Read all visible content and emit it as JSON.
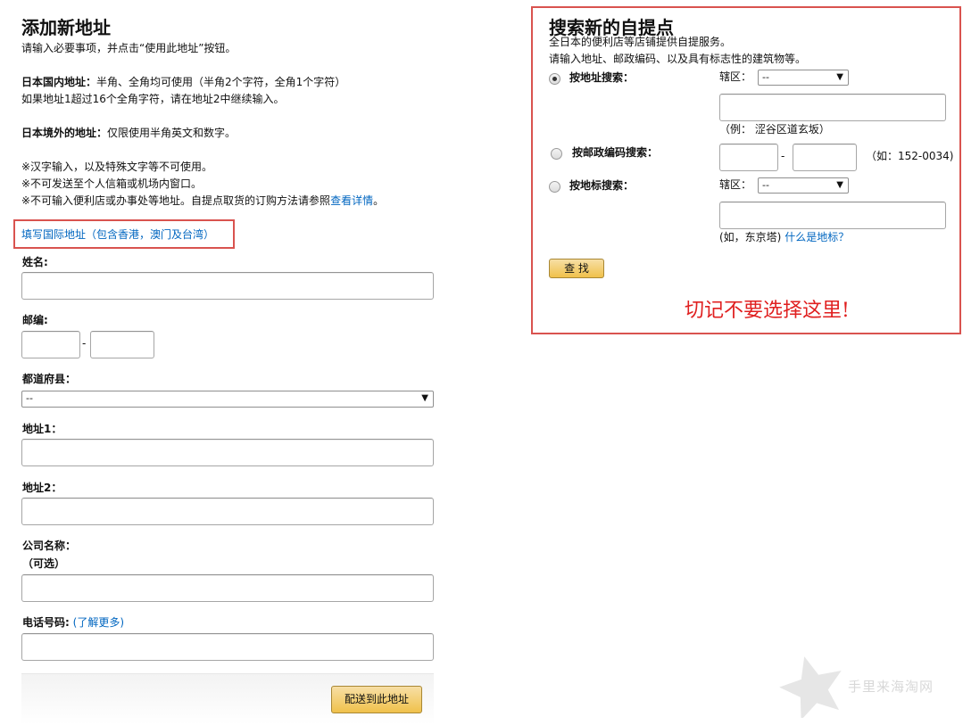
{
  "left": {
    "title": "添加新地址",
    "subtitle": "请输入必要事项，并点击“使用此地址”按钮。",
    "domestic_label": "日本国内地址：",
    "domestic_text": "半角、全角均可使用（半角2个字符，全角1个字符）",
    "domestic_note": "如果地址1超过16个全角字符，请在地址2中继续输入。",
    "overseas_label": "日本境外的地址：",
    "overseas_text": "仅限使用半角英文和数字。",
    "note1": "※汉字输入，以及特殊文字等不可使用。",
    "note2": "※不可发送至个人信箱或机场内窗口。",
    "note3": "※不可输入便利店或办事处等地址。自提点取货的订购方法请参照",
    "note3_link": "查看详情",
    "note3_end": "。",
    "intl_link": "填写国际地址（包含香港，澳门及台湾）",
    "name_label": "姓名:",
    "zip_label": "邮编:",
    "zip_dash": "-",
    "pref_label": "都道府县：",
    "pref_value": "--",
    "addr1_label": "地址1：",
    "addr2_label": "地址2：",
    "company_label": "公司名称：",
    "company_optional": "（可选）",
    "phone_label": "电话号码:",
    "phone_link_open": "(",
    "phone_link": "了解更多",
    "phone_link_close": ")",
    "submit_button": "配送到此地址"
  },
  "right": {
    "title": "搜索新的自提点",
    "desc1": "全日本的便利店等店铺提供自提服务。",
    "desc2": "请输入地址、邮政编码、以及具有标志性的建筑物等。",
    "by_address_label": "按地址搜索：",
    "region_label": "辖区：",
    "region_value": "--",
    "address_example": "（例： 涩谷区道玄坂）",
    "by_zip_label": "按邮政编码搜索：",
    "zip_dash": "-",
    "zip_example": "（如：152-0034)",
    "by_landmark_label": "按地标搜索：",
    "region_label2": "辖区：",
    "region_value2": "--",
    "landmark_example": "(如，东京塔)",
    "landmark_link": "什么是地标？",
    "search_button": "查 找",
    "warning": "切记不要选择这里!"
  },
  "watermark": "手里来海淘网",
  "colors": {
    "link": "#0066c0",
    "annotation_red": "#d9534f",
    "warning_red": "#e02020",
    "button_yellow": "#f0c14b"
  },
  "icons": [
    "chevron-down-icon",
    "star-watermark-icon"
  ]
}
